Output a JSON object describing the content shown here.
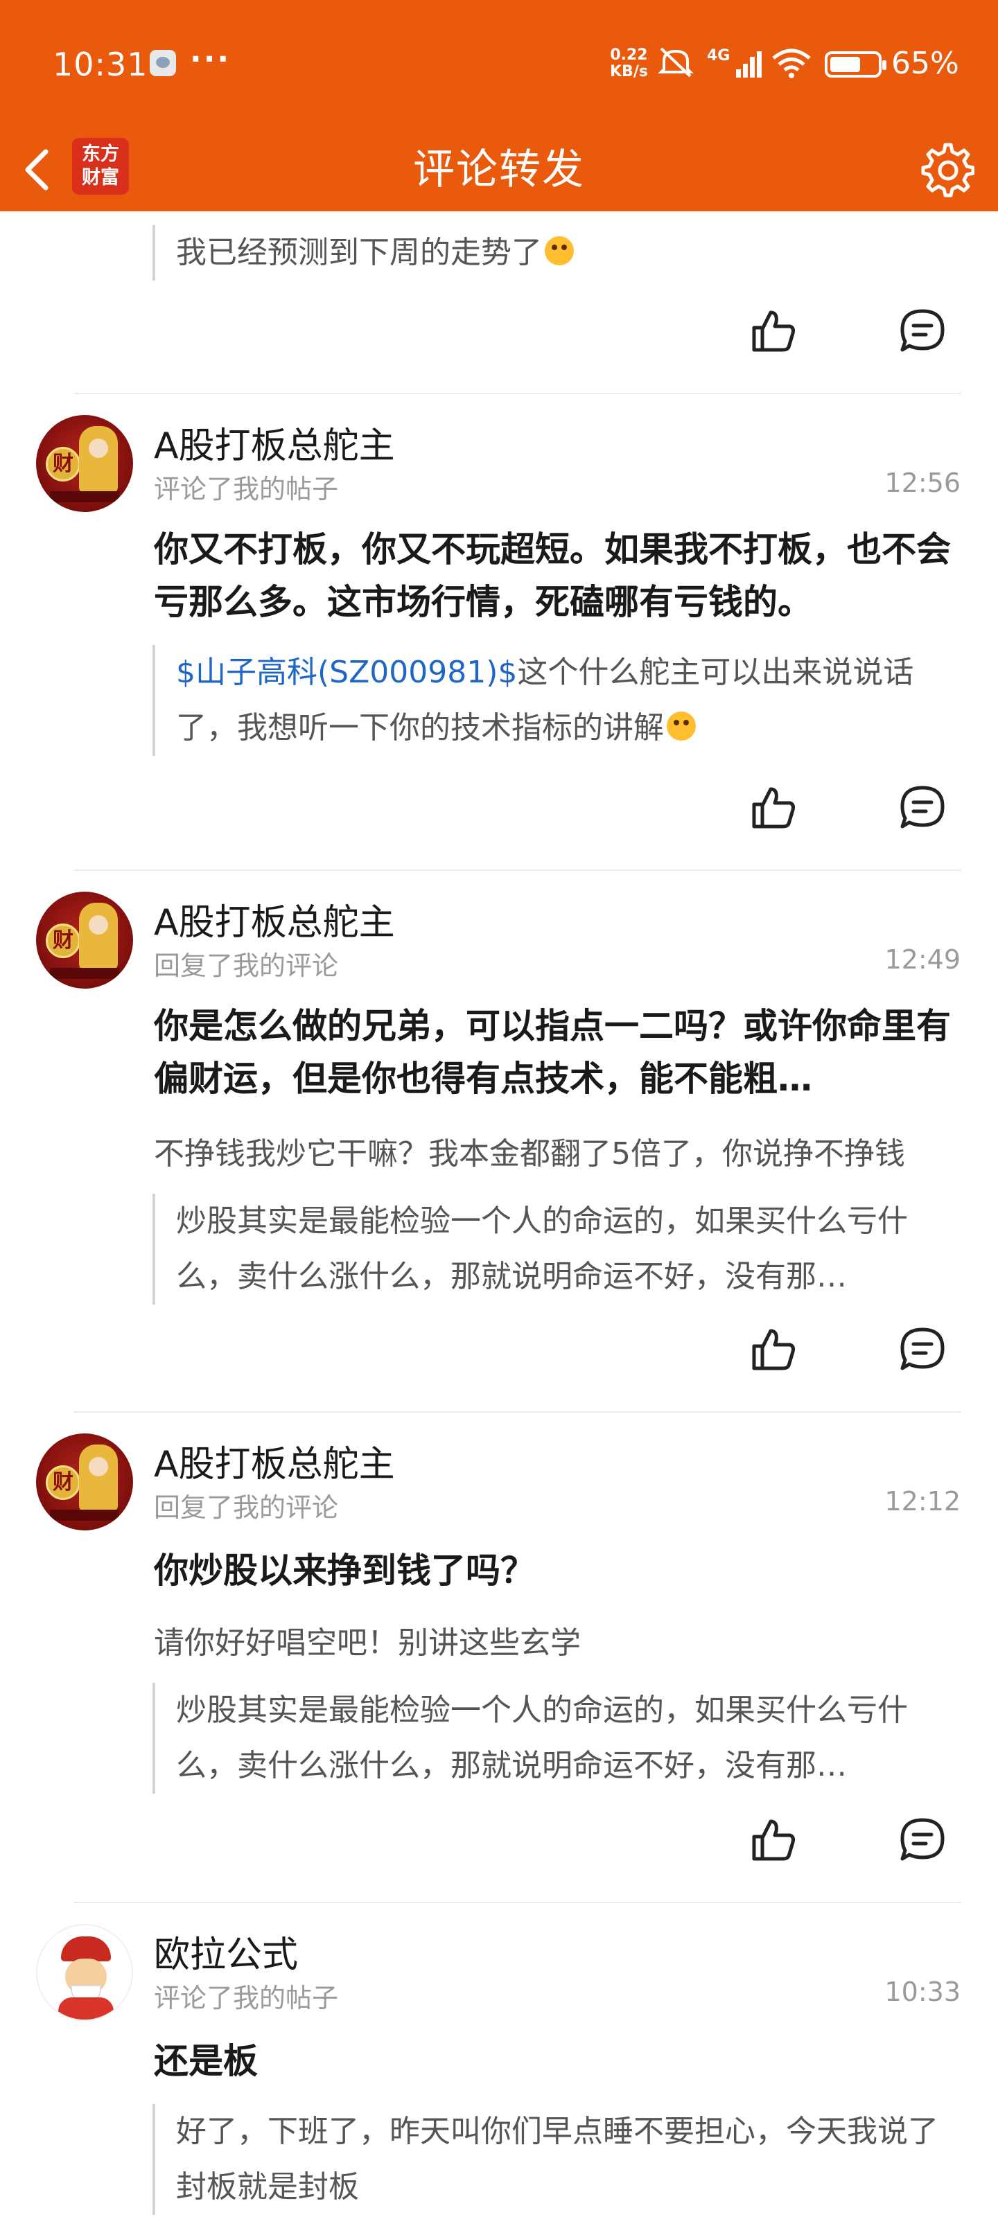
{
  "status_bar": {
    "time": "10:31",
    "dots": "···",
    "speed_value": "0.22",
    "speed_unit": "KB/s",
    "network": "4G",
    "battery_level": 0.65,
    "battery_pct": "65%"
  },
  "nav": {
    "title": "评论转发",
    "brand_line1": "东方",
    "brand_line2": "财富",
    "back_icon": "chevron-left-icon",
    "settings_icon": "gear-icon"
  },
  "colors": {
    "header_bg": "#ea5a0c",
    "link": "#1f66c7",
    "muted": "#9a9a9a"
  },
  "items": [
    {
      "quote": "我已经预测到下周的走势了",
      "quote_emoji": "grinning-emoji"
    },
    {
      "username": "A股打板总舵主",
      "action": "评论了我的帖子",
      "time": "12:56",
      "text": "你又不打板，你又不玩超短。如果我不打板，也不会亏那么多。这市场行情，死磕哪有亏钱的。",
      "quote_link": "$山子高科(SZ000981)$",
      "quote": "这个什么舵主可以出来说说话了，我想听一下你的技术指标的讲解",
      "quote_emoji": "yawning-emoji"
    },
    {
      "username": "A股打板总舵主",
      "action": "回复了我的评论",
      "time": "12:49",
      "text": "你是怎么做的兄弟，可以指点一二吗？或许你命里有偏财运，但是你也得有点技术，能不能粗…",
      "sub": "不挣钱我炒它干嘛？我本金都翻了5倍了，你说挣不挣钱",
      "quote": "炒股其实是最能检验一个人的命运的，如果买什么亏什么，卖什么涨什么，那就说明命运不好，没有那…"
    },
    {
      "username": "A股打板总舵主",
      "action": "回复了我的评论",
      "time": "12:12",
      "text": "你炒股以来挣到钱了吗？",
      "sub": "请你好好唱空吧！别讲这些玄学",
      "quote": "炒股其实是最能检验一个人的命运的，如果买什么亏什么，卖什么涨什么，那就说明命运不好，没有那…"
    },
    {
      "username": "欧拉公式",
      "action": "评论了我的帖子",
      "time": "10:33",
      "text": "还是板",
      "quote": "好了，下班了，昨天叫你们早点睡不要担心，今天我说了封板就是封板"
    }
  ],
  "avatar_glyph": "财"
}
